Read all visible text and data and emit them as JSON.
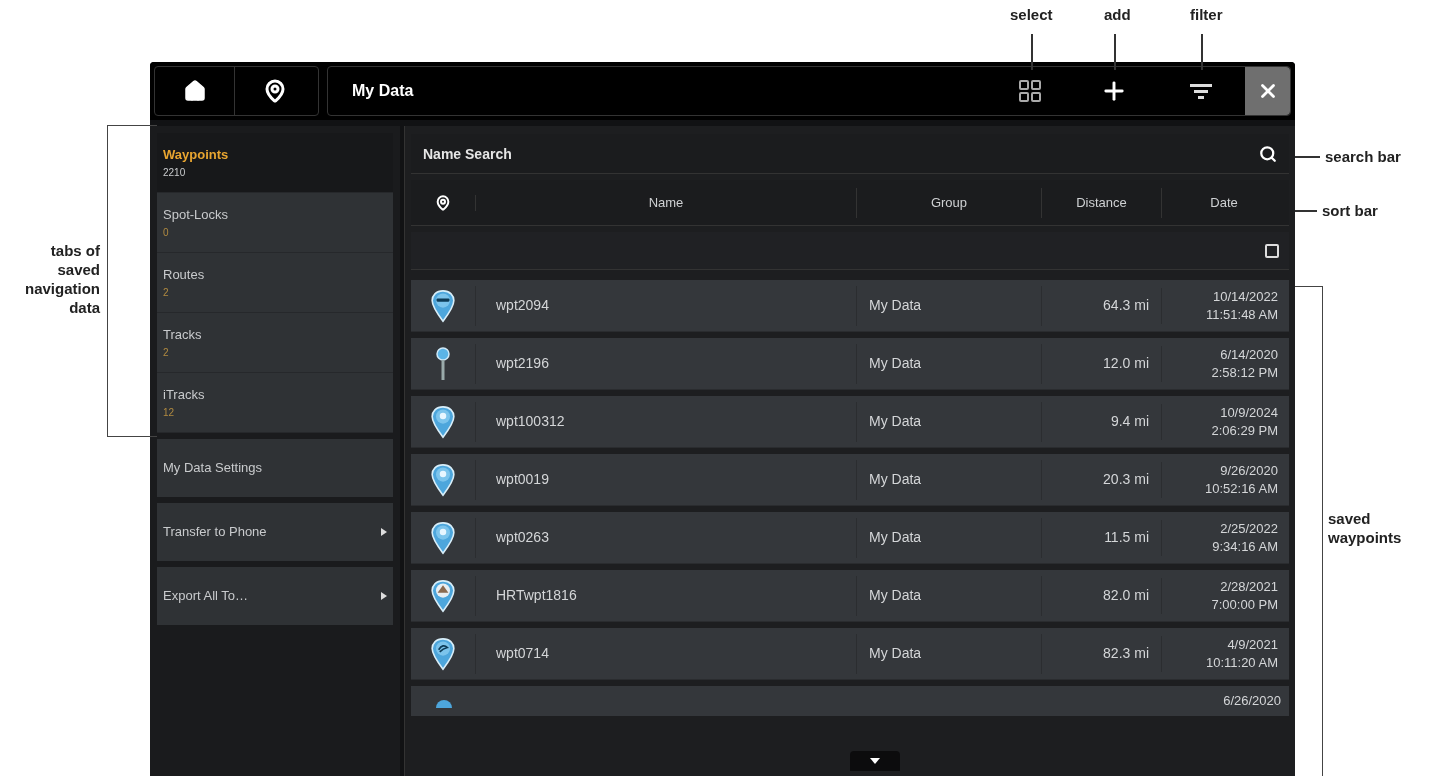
{
  "callouts": {
    "toolbar": [
      "select",
      "add",
      "filter"
    ],
    "search_bar": "search bar",
    "sort_bar": "sort bar",
    "list": "saved waypoints",
    "tabs": "tabs of saved navigation data"
  },
  "title": "My Data",
  "tabs": [
    {
      "label": "Waypoints",
      "count": "2210",
      "selected": true
    },
    {
      "label": "Spot-Locks",
      "count": "0",
      "selected": false
    },
    {
      "label": "Routes",
      "count": "2",
      "selected": false
    },
    {
      "label": "Tracks",
      "count": "2",
      "selected": false
    },
    {
      "label": "iTracks",
      "count": "12",
      "selected": false
    }
  ],
  "sidebar_buttons": [
    {
      "label": "My Data Settings",
      "kind": "plain"
    },
    {
      "label": "Transfer to Phone",
      "kind": "submenu"
    },
    {
      "label": "Export All To…",
      "kind": "submenu"
    }
  ],
  "search": {
    "placeholder": "Name Search"
  },
  "columns": [
    "Name",
    "Group",
    "Distance",
    "Date"
  ],
  "select_all": {
    "checked": false
  },
  "rows": [
    {
      "kind": "buoy",
      "name": "wpt2094",
      "group": "My Data",
      "distance": "64.3 mi",
      "date": "10/14/2022",
      "time": "11:51:48 AM"
    },
    {
      "kind": "stick",
      "name": "wpt2196",
      "group": "My Data",
      "distance": "12.0 mi",
      "date": "6/14/2020",
      "time": "2:58:12 PM"
    },
    {
      "kind": "dot",
      "name": "wpt100312",
      "group": "My Data",
      "distance": "9.4 mi",
      "date": "10/9/2024",
      "time": "2:06:29 PM"
    },
    {
      "kind": "dot",
      "name": "wpt0019",
      "group": "My Data",
      "distance": "20.3 mi",
      "date": "9/26/2020",
      "time": "10:52:16 AM"
    },
    {
      "kind": "dot",
      "name": "wpt0263",
      "group": "My Data",
      "distance": "11.5 mi",
      "date": "2/25/2022",
      "time": "9:34:16 AM"
    },
    {
      "kind": "peak",
      "name": "HRTwpt1816",
      "group": "My Data",
      "distance": "82.0 mi",
      "date": "2/28/2021",
      "time": "7:00:00 PM"
    },
    {
      "kind": "swirl",
      "name": "wpt0714",
      "group": "My Data",
      "distance": "82.3 mi",
      "date": "4/9/2021",
      "time": "10:11:20 AM"
    }
  ],
  "partial_row": {
    "kind": "dot",
    "date": "6/26/2020"
  }
}
